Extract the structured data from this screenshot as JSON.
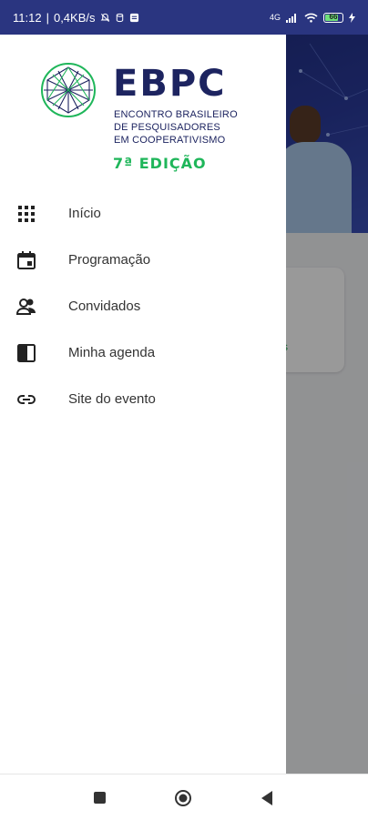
{
  "status_bar": {
    "time": "11:12",
    "speed": "0,4KB/s",
    "network": "4G",
    "battery": "66"
  },
  "background": {
    "card_text": "o",
    "card_link": "tes",
    "text2": "s."
  },
  "drawer": {
    "logo": {
      "brand": "EBPC",
      "line1": "ENCONTRO BRASILEIRO",
      "line2": "DE PESQUISADORES",
      "line3": "EM COOPERATIVISMO",
      "edition": "7ª EDIÇÃO"
    },
    "menu": [
      {
        "label": "Início",
        "icon": "grid-icon"
      },
      {
        "label": "Programação",
        "icon": "calendar-icon"
      },
      {
        "label": "Convidados",
        "icon": "people-icon"
      },
      {
        "label": "Minha agenda",
        "icon": "agenda-icon"
      },
      {
        "label": "Site do evento",
        "icon": "link-icon"
      }
    ]
  },
  "colors": {
    "status_bar": "#2a3580",
    "brand": "#1d2460",
    "accent": "#1fb65a"
  }
}
